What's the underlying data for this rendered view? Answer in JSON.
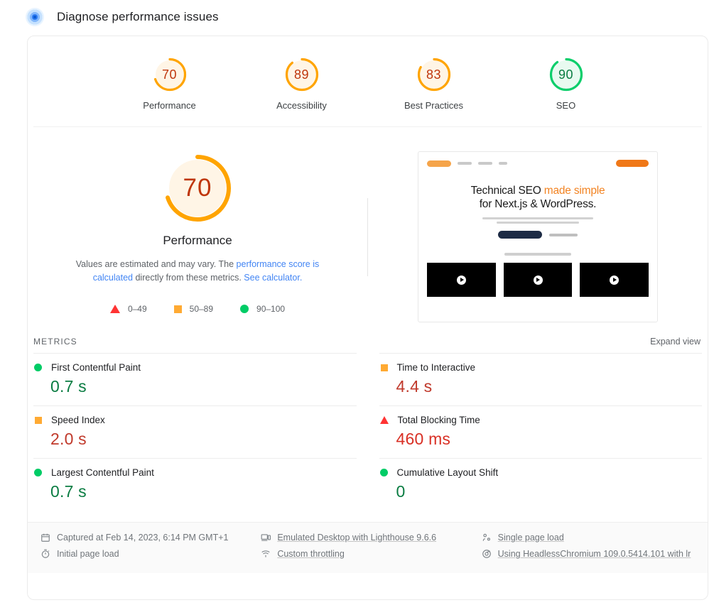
{
  "header": {
    "title": "Diagnose performance issues",
    "logo_icon": "lighthouse-icon"
  },
  "category_gauges": [
    {
      "score": "70",
      "label": "Performance",
      "color": "#ffa400",
      "track": "#fff5e6"
    },
    {
      "score": "89",
      "label": "Accessibility",
      "color": "#ffa400",
      "track": "#fff5e6"
    },
    {
      "score": "83",
      "label": "Best Practices",
      "color": "#ffa400",
      "track": "#fff5e6"
    },
    {
      "score": "90",
      "label": "SEO",
      "color": "#0cce6b",
      "track": "#e8faf0"
    }
  ],
  "hero": {
    "gauge": {
      "score": "70",
      "label": "Performance",
      "color": "#ffa400",
      "track": "#fff5e6"
    },
    "note_prefix": "Values are estimated and may vary. The ",
    "note_link1": "performance score is calculated",
    "note_middle": " directly from these metrics. ",
    "note_link2": "See calculator.",
    "legend": [
      {
        "icon": "triangle-red-icon",
        "range": "0–49"
      },
      {
        "icon": "square-orange-icon",
        "range": "50–89"
      },
      {
        "icon": "circle-green-icon",
        "range": "90–100"
      }
    ]
  },
  "thumbnail": {
    "alt": "page-screenshot",
    "heading_line1_plain": "Technical SEO ",
    "heading_line1_accent": "made simple",
    "heading_line2": "for Next.js & WordPress."
  },
  "metrics": {
    "section_label": "METRICS",
    "expand_label": "Expand view",
    "items": [
      {
        "name": "First Contentful Paint",
        "value": "0.7 s",
        "icon": "circle-green-icon",
        "value_color": "#0a7c42"
      },
      {
        "name": "Time to Interactive",
        "value": "4.4 s",
        "icon": "square-orange-icon",
        "value_color": "#c0392b"
      },
      {
        "name": "Speed Index",
        "value": "2.0 s",
        "icon": "square-orange-icon",
        "value_color": "#c0392b"
      },
      {
        "name": "Total Blocking Time",
        "value": "460 ms",
        "icon": "triangle-red-icon",
        "value_color": "#d93025"
      },
      {
        "name": "Largest Contentful Paint",
        "value": "0.7 s",
        "icon": "circle-green-icon",
        "value_color": "#0a7c42"
      },
      {
        "name": "Cumulative Layout Shift",
        "value": "0",
        "icon": "circle-green-icon",
        "value_color": "#0a7c42"
      }
    ]
  },
  "environment": {
    "captured_at": "Captured at Feb 14, 2023, 6:14 PM GMT+1",
    "page_load": "Initial page load",
    "emulation": "Emulated Desktop with Lighthouse 9.6.6",
    "throttling": "Custom throttling",
    "load_type": "Single page load",
    "user_agent": "Using HeadlessChromium 109.0.5414.101 with lr"
  }
}
